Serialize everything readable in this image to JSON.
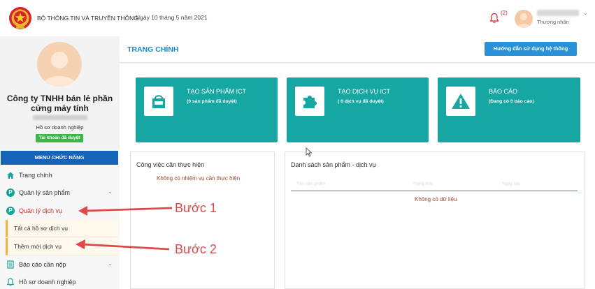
{
  "header": {
    "org_name": "BỘ THÔNG TIN VÀ TRUYỀN THÔNG",
    "date": "Ngày 10 tháng 5 năm 2021",
    "notification_count": "(2)",
    "user_role": "Thương nhân"
  },
  "sidebar": {
    "company_name": "Công ty TNHH bán lẻ phần cứng máy tính",
    "profile_label": "Hồ sơ doanh nghiệp",
    "account_status": "Tài khoản đã duyệt",
    "menu_header": "MENU CHỨC NĂNG",
    "items": [
      {
        "label": "Trang chính",
        "icon": "home-icon"
      },
      {
        "label": "Quản lý sản phẩm",
        "icon": "p-circle-icon"
      },
      {
        "label": "Quản lý dịch vụ",
        "icon": "p-circle-icon"
      },
      {
        "label": "Tất cả hồ sơ dịch vụ"
      },
      {
        "label": "Thêm mới dịch vụ"
      },
      {
        "label": "Báo cáo cần nộp",
        "icon": "document-icon"
      },
      {
        "label": "Hồ sơ doanh nghiệp",
        "icon": "bell-icon"
      }
    ]
  },
  "main": {
    "page_title": "TRANG CHÍNH",
    "guide_button": "Hướng dẫn sử dụng hệ thống",
    "cards": [
      {
        "title": "TẠO SẢN PHẨM ICT",
        "subtitle": "(0 sản phẩm đã duyệt)",
        "icon": "shopping-bag-icon"
      },
      {
        "title": "TẠO DỊCH VỤ ICT",
        "subtitle": "( 0 dịch vụ đã duyệt)",
        "icon": "puzzle-icon"
      },
      {
        "title": "BÁO CÁO",
        "subtitle": "(Đang có 0 báo cáo)",
        "icon": "warning-icon"
      }
    ],
    "tasks_panel": {
      "title": "Công việc cần thực hiện",
      "empty_text": "Không có nhiệm vụ cần thực hiện"
    },
    "products_panel": {
      "title": "Danh sách sản phẩm - dịch vụ",
      "columns": [
        "Tên sản phẩm",
        "Trạng thái",
        "Ngày tạo"
      ],
      "empty_text": "Không có dữ liệu"
    }
  },
  "annotations": {
    "step1": "Bước 1",
    "step2": "Bước 2"
  },
  "colors": {
    "teal": "#17a7a2",
    "menu_blue": "#1564b8",
    "title_blue": "#1e8bc3",
    "annotation_red": "#e04848",
    "badge_green": "#3cb54a"
  }
}
